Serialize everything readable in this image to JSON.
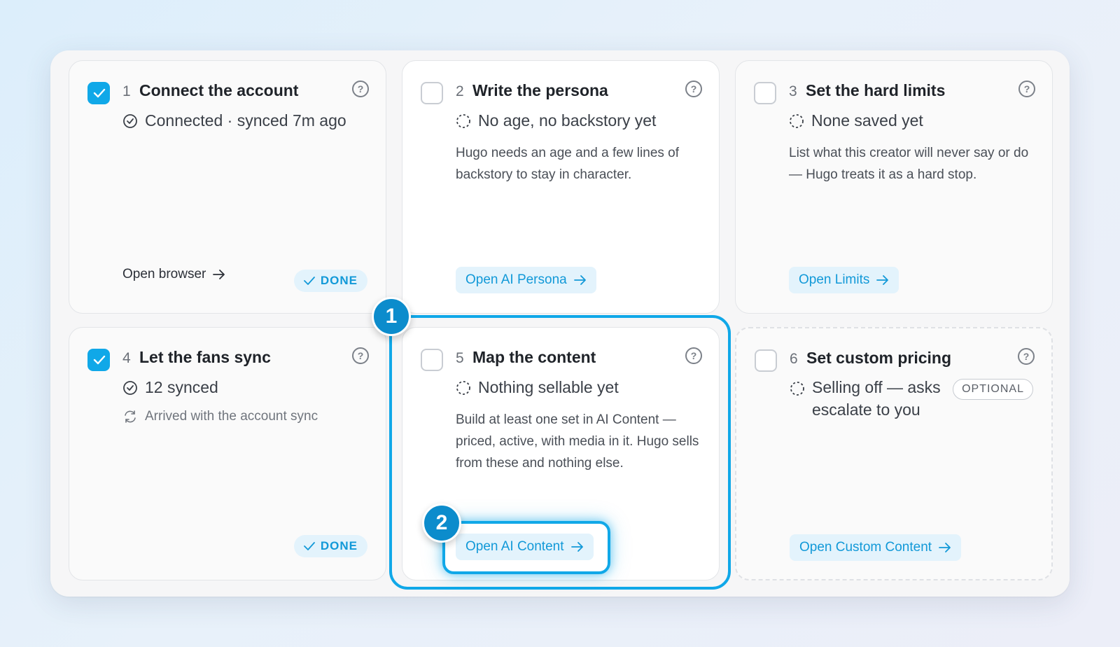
{
  "steps": [
    {
      "num": "1",
      "title": "Connect the account",
      "status": "Connected · synced 7m ago",
      "link_label": "Open browser",
      "done_label": "DONE"
    },
    {
      "num": "2",
      "title": "Write the persona",
      "status": "No age, no backstory yet",
      "description": "Hugo needs an age and a few lines of backstory to stay in character.",
      "button_label": "Open AI Persona"
    },
    {
      "num": "3",
      "title": "Set the hard limits",
      "status": "None saved yet",
      "description": "List what this creator will never say or do — Hugo treats it as a hard stop.",
      "button_label": "Open Limits"
    },
    {
      "num": "4",
      "title": "Let the fans sync",
      "status": "12 synced",
      "sub_status": "Arrived with the account sync",
      "done_label": "DONE"
    },
    {
      "num": "5",
      "title": "Map the content",
      "status": "Nothing sellable yet",
      "description": "Build at least one set in AI Content — priced, active, with media in it. Hugo sells from these and nothing else.",
      "button_label": "Open AI Content"
    },
    {
      "num": "6",
      "title": "Set custom pricing",
      "status_line1": "Selling off — asks",
      "status_line2": "escalate to you",
      "optional_label": "OPTIONAL",
      "button_label": "Open Custom Content"
    }
  ],
  "annotations": {
    "badge_1": "1",
    "badge_2": "2"
  },
  "help_glyph": "?",
  "colors": {
    "accent": "#10a8e8",
    "accent_light": "#e3f3fc",
    "badge": "#0c8ccc"
  }
}
